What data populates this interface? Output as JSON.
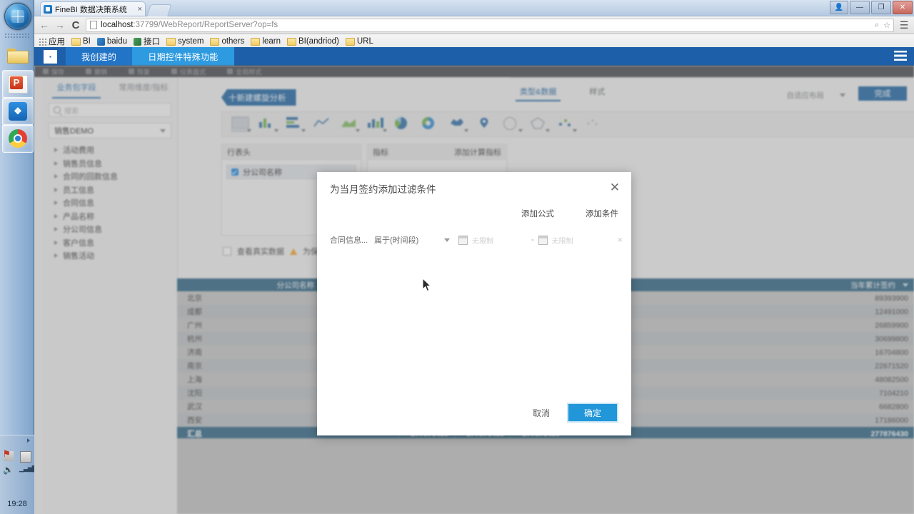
{
  "taskbar": {
    "start_label": "start-orb",
    "items": [
      {
        "name": "folder",
        "label": "Windows Explorer"
      },
      {
        "name": "powerpoint",
        "label": "P"
      },
      {
        "name": "finebi-app",
        "label": "B"
      },
      {
        "name": "chrome",
        "label": "Google Chrome"
      }
    ],
    "clock": "19:28"
  },
  "browser": {
    "tab_title": "FineBI 数据决策系统",
    "tab_close": "×",
    "window_buttons": {
      "user": "👤",
      "minimize": "—",
      "maximize": "❐",
      "close": "✕"
    },
    "nav": {
      "back": "←",
      "forward": "→",
      "reload": "C"
    },
    "url_host": "localhost",
    "url_path": ":37799/WebReport/ReportServer?op=fs",
    "url_tools": {
      "zoom": "⌕",
      "star": "☆"
    },
    "menu": "☰",
    "bookmarks": [
      {
        "label": "应用",
        "icon": "apps-grid-icon"
      },
      {
        "label": "BI",
        "icon": "folder-icon"
      },
      {
        "label": "baidu",
        "icon": "site-icon"
      },
      {
        "label": "接口",
        "icon": "site-icon"
      },
      {
        "label": "system",
        "icon": "folder-icon"
      },
      {
        "label": "others",
        "icon": "folder-icon"
      },
      {
        "label": "learn",
        "icon": "folder-icon"
      },
      {
        "label": "BI(andriod)",
        "icon": "folder-icon"
      },
      {
        "label": "URL",
        "icon": "folder-icon"
      }
    ]
  },
  "app": {
    "tabs": [
      {
        "label": "我创建的"
      },
      {
        "label": "日期控件特殊功能"
      }
    ],
    "hamburger": "☰",
    "toolbar": [
      {
        "label": "保存"
      },
      {
        "label": "撤销"
      },
      {
        "label": "恢复"
      },
      {
        "label": "仪表盘式"
      },
      {
        "label": "全局样式"
      }
    ],
    "done_button": "完成",
    "adapt_label": "自适应布局"
  },
  "left_panel": {
    "tabs": [
      {
        "label": "业务包字段",
        "active": true
      },
      {
        "label": "常用维度/指标",
        "active": false
      }
    ],
    "search_placeholder": "搜索",
    "selected_package": "销售DEMO",
    "tree": [
      {
        "label": "活动费用"
      },
      {
        "label": "销售员信息"
      },
      {
        "label": "合同的回款信息"
      },
      {
        "label": "员工信息"
      },
      {
        "label": "合同信息"
      },
      {
        "label": "产品名称"
      },
      {
        "label": "分公司信息"
      },
      {
        "label": "客户信息"
      },
      {
        "label": "销售活动"
      }
    ]
  },
  "main": {
    "new_analysis_button": "十新建螺旋分析",
    "right_tabs": [
      {
        "label": "类型&数据",
        "active": true
      },
      {
        "label": "样式",
        "active": false
      }
    ],
    "row_header_box": {
      "title": "行表头",
      "field": "分公司名称"
    },
    "metric_box": {
      "title": "指标",
      "action": "添加计算指标"
    },
    "real_data_checkbox": "查看真实数据",
    "real_data_note": "为保证流畅性，非"
  },
  "table": {
    "columns": [
      "分公司名称",
      "当年累计签约"
    ],
    "rows": [
      {
        "name": "北京",
        "value": "89393900"
      },
      {
        "name": "成都",
        "value": "12491000"
      },
      {
        "name": "广州",
        "value": "26859900"
      },
      {
        "name": "杭州",
        "value": "30699800"
      },
      {
        "name": "济南",
        "value": "16704800"
      },
      {
        "name": "南京",
        "value": "22671520"
      },
      {
        "name": "上海",
        "value": "48082500"
      },
      {
        "name": "沈阳",
        "value": "7104210"
      },
      {
        "name": "武汉",
        "value": "6682800"
      },
      {
        "name": "西安",
        "value": "17186000"
      }
    ],
    "total": {
      "label": "汇总",
      "mid_values": [
        "277876430",
        "277876430",
        "277876430"
      ],
      "value": "277876430"
    }
  },
  "modal": {
    "title": "为当月签约添加过滤条件",
    "close": "✕",
    "add_formula": "添加公式",
    "add_condition": "添加条件",
    "condition": {
      "field": "合同信息...",
      "operator": "属于(时间段)",
      "start_placeholder": "无限制",
      "end_placeholder": "无限制",
      "separator": "-",
      "remove": "×"
    },
    "cancel": "取消",
    "confirm": "确定"
  },
  "colors": {
    "app_blue": "#1d5fa8",
    "accent_blue": "#2196d8",
    "table_header": "#3d6f8c",
    "tab_active": "#2e9ae0"
  }
}
